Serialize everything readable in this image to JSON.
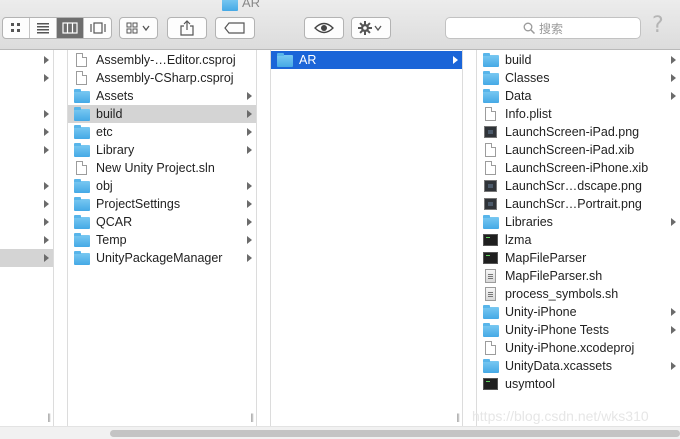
{
  "window": {
    "title": "AR"
  },
  "toolbar": {
    "view_buttons": [
      "icon-view",
      "list-view",
      "column-view",
      "cover-flow-view"
    ],
    "active_view": "column-view",
    "search": {
      "placeholder": "搜索"
    },
    "help_label": "?"
  },
  "columns": {
    "col1": [
      {
        "name": "Assembly-…Editor.csproj",
        "kind": "doc",
        "arrow": false
      },
      {
        "name": "Assembly-CSharp.csproj",
        "kind": "doc",
        "arrow": false
      },
      {
        "name": "Assets",
        "kind": "folder",
        "arrow": true
      },
      {
        "name": "build",
        "kind": "folder",
        "arrow": true,
        "selected": "gray"
      },
      {
        "name": "etc",
        "kind": "folder",
        "arrow": true
      },
      {
        "name": "Library",
        "kind": "folder",
        "arrow": true
      },
      {
        "name": "New Unity Project.sln",
        "kind": "doc",
        "arrow": false
      },
      {
        "name": "obj",
        "kind": "folder",
        "arrow": true
      },
      {
        "name": "ProjectSettings",
        "kind": "folder",
        "arrow": true
      },
      {
        "name": "QCAR",
        "kind": "folder",
        "arrow": true
      },
      {
        "name": "Temp",
        "kind": "folder",
        "arrow": true
      },
      {
        "name": "UnityPackageManager",
        "kind": "folder",
        "arrow": true
      }
    ],
    "col2": [
      {
        "name": "AR",
        "kind": "folder",
        "arrow": true,
        "selected": "blue"
      }
    ],
    "col3": [
      {
        "name": "build",
        "kind": "folder",
        "arrow": true
      },
      {
        "name": "Classes",
        "kind": "folder",
        "arrow": true
      },
      {
        "name": "Data",
        "kind": "folder",
        "arrow": true
      },
      {
        "name": "Info.plist",
        "kind": "doc",
        "arrow": false
      },
      {
        "name": "LaunchScreen-iPad.png",
        "kind": "img",
        "arrow": false
      },
      {
        "name": "LaunchScreen-iPad.xib",
        "kind": "doc",
        "arrow": false
      },
      {
        "name": "LaunchScreen-iPhone.xib",
        "kind": "doc",
        "arrow": false
      },
      {
        "name": "LaunchScr…dscape.png",
        "kind": "img",
        "arrow": false
      },
      {
        "name": "LaunchScr…Portrait.png",
        "kind": "img",
        "arrow": false
      },
      {
        "name": "Libraries",
        "kind": "folder",
        "arrow": true
      },
      {
        "name": "lzma",
        "kind": "exec",
        "arrow": false
      },
      {
        "name": "MapFileParser",
        "kind": "exec",
        "arrow": false
      },
      {
        "name": "MapFileParser.sh",
        "kind": "script",
        "arrow": false
      },
      {
        "name": "process_symbols.sh",
        "kind": "script",
        "arrow": false
      },
      {
        "name": "Unity-iPhone",
        "kind": "folder",
        "arrow": true
      },
      {
        "name": "Unity-iPhone Tests",
        "kind": "folder",
        "arrow": true
      },
      {
        "name": "Unity-iPhone.xcodeproj",
        "kind": "doc",
        "arrow": false
      },
      {
        "name": "UnityData.xcassets",
        "kind": "folder",
        "arrow": true
      },
      {
        "name": "usymtool",
        "kind": "exec",
        "arrow": false
      }
    ]
  },
  "watermark": "https://blog.csdn.net/wks310"
}
